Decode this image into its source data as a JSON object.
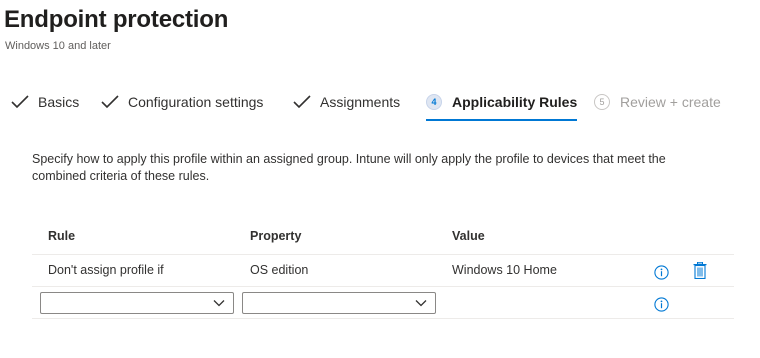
{
  "header": {
    "title": "Endpoint protection",
    "subtitle": "Windows 10 and later"
  },
  "tabs": [
    {
      "label": "Basics",
      "state": "done"
    },
    {
      "label": "Configuration settings",
      "state": "done"
    },
    {
      "label": "Assignments",
      "state": "done"
    },
    {
      "label": "Applicability Rules",
      "state": "active",
      "step": "4"
    },
    {
      "label": "Review + create",
      "state": "disabled",
      "step": "5"
    }
  ],
  "description": "Specify how to apply this profile within an assigned group. Intune will only apply the profile to devices that meet the combined criteria of these rules.",
  "table": {
    "headers": {
      "rule": "Rule",
      "property": "Property",
      "value": "Value"
    },
    "rows": [
      {
        "rule": "Don't assign profile if",
        "property": "OS edition",
        "value": "Windows 10 Home"
      }
    ],
    "new_row": {
      "rule_selected": "",
      "property_selected": ""
    }
  },
  "colors": {
    "accent": "#0078d4",
    "disabled": "#a19f9d",
    "text": "#323130"
  }
}
